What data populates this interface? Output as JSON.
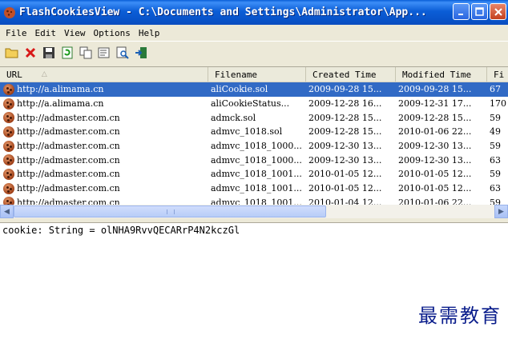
{
  "window": {
    "title": "FlashCookiesView  -  C:\\Documents and Settings\\Administrator\\App..."
  },
  "menu": [
    "File",
    "Edit",
    "View",
    "Options",
    "Help"
  ],
  "toolbar": {
    "icons": [
      "open-folder-icon",
      "delete-icon",
      "save-icon",
      "refresh-icon",
      "copy-icon",
      "properties-icon",
      "find-icon",
      "exit-icon"
    ]
  },
  "table": {
    "columns": [
      "URL",
      "Filename",
      "Created Time",
      "Modified Time",
      "Fi"
    ],
    "rows": [
      {
        "url": "http://a.alimama.cn",
        "filename": "aliCookie.sol",
        "created": "2009-09-28 15...",
        "modified": "2009-09-28 15...",
        "size": "67"
      },
      {
        "url": "http://a.alimama.cn",
        "filename": "aliCookieStatus...",
        "created": "2009-12-28 16...",
        "modified": "2009-12-31 17...",
        "size": "170"
      },
      {
        "url": "http://admaster.com.cn",
        "filename": "admck.sol",
        "created": "2009-12-28 15...",
        "modified": "2009-12-28 15...",
        "size": "59"
      },
      {
        "url": "http://admaster.com.cn",
        "filename": "admvc_1018.sol",
        "created": "2009-12-28 15...",
        "modified": "2010-01-06 22...",
        "size": "49"
      },
      {
        "url": "http://admaster.com.cn",
        "filename": "admvc_1018_1000...",
        "created": "2009-12-30 13...",
        "modified": "2009-12-30 13...",
        "size": "59"
      },
      {
        "url": "http://admaster.com.cn",
        "filename": "admvc_1018_1000...",
        "created": "2009-12-30 13...",
        "modified": "2009-12-30 13...",
        "size": "63"
      },
      {
        "url": "http://admaster.com.cn",
        "filename": "admvc_1018_1001...",
        "created": "2010-01-05 12...",
        "modified": "2010-01-05 12...",
        "size": "59"
      },
      {
        "url": "http://admaster.com.cn",
        "filename": "admvc_1018_1001...",
        "created": "2010-01-05 12...",
        "modified": "2010-01-05 12...",
        "size": "63"
      },
      {
        "url": "http://admaster.com.cn",
        "filename": "admvc_1018_1001...",
        "created": "2010-01-04 12...",
        "modified": "2010-01-06 22...",
        "size": "59"
      }
    ],
    "selected_index": 0
  },
  "detail": {
    "text": "cookie: String = olNHA9RvvQECARrP4N2kczGl"
  },
  "watermark": "最需教育",
  "colors": {
    "selection": "#316ac5",
    "titlebar": "#0b5ed7",
    "watermark": "#0b1e8c"
  }
}
